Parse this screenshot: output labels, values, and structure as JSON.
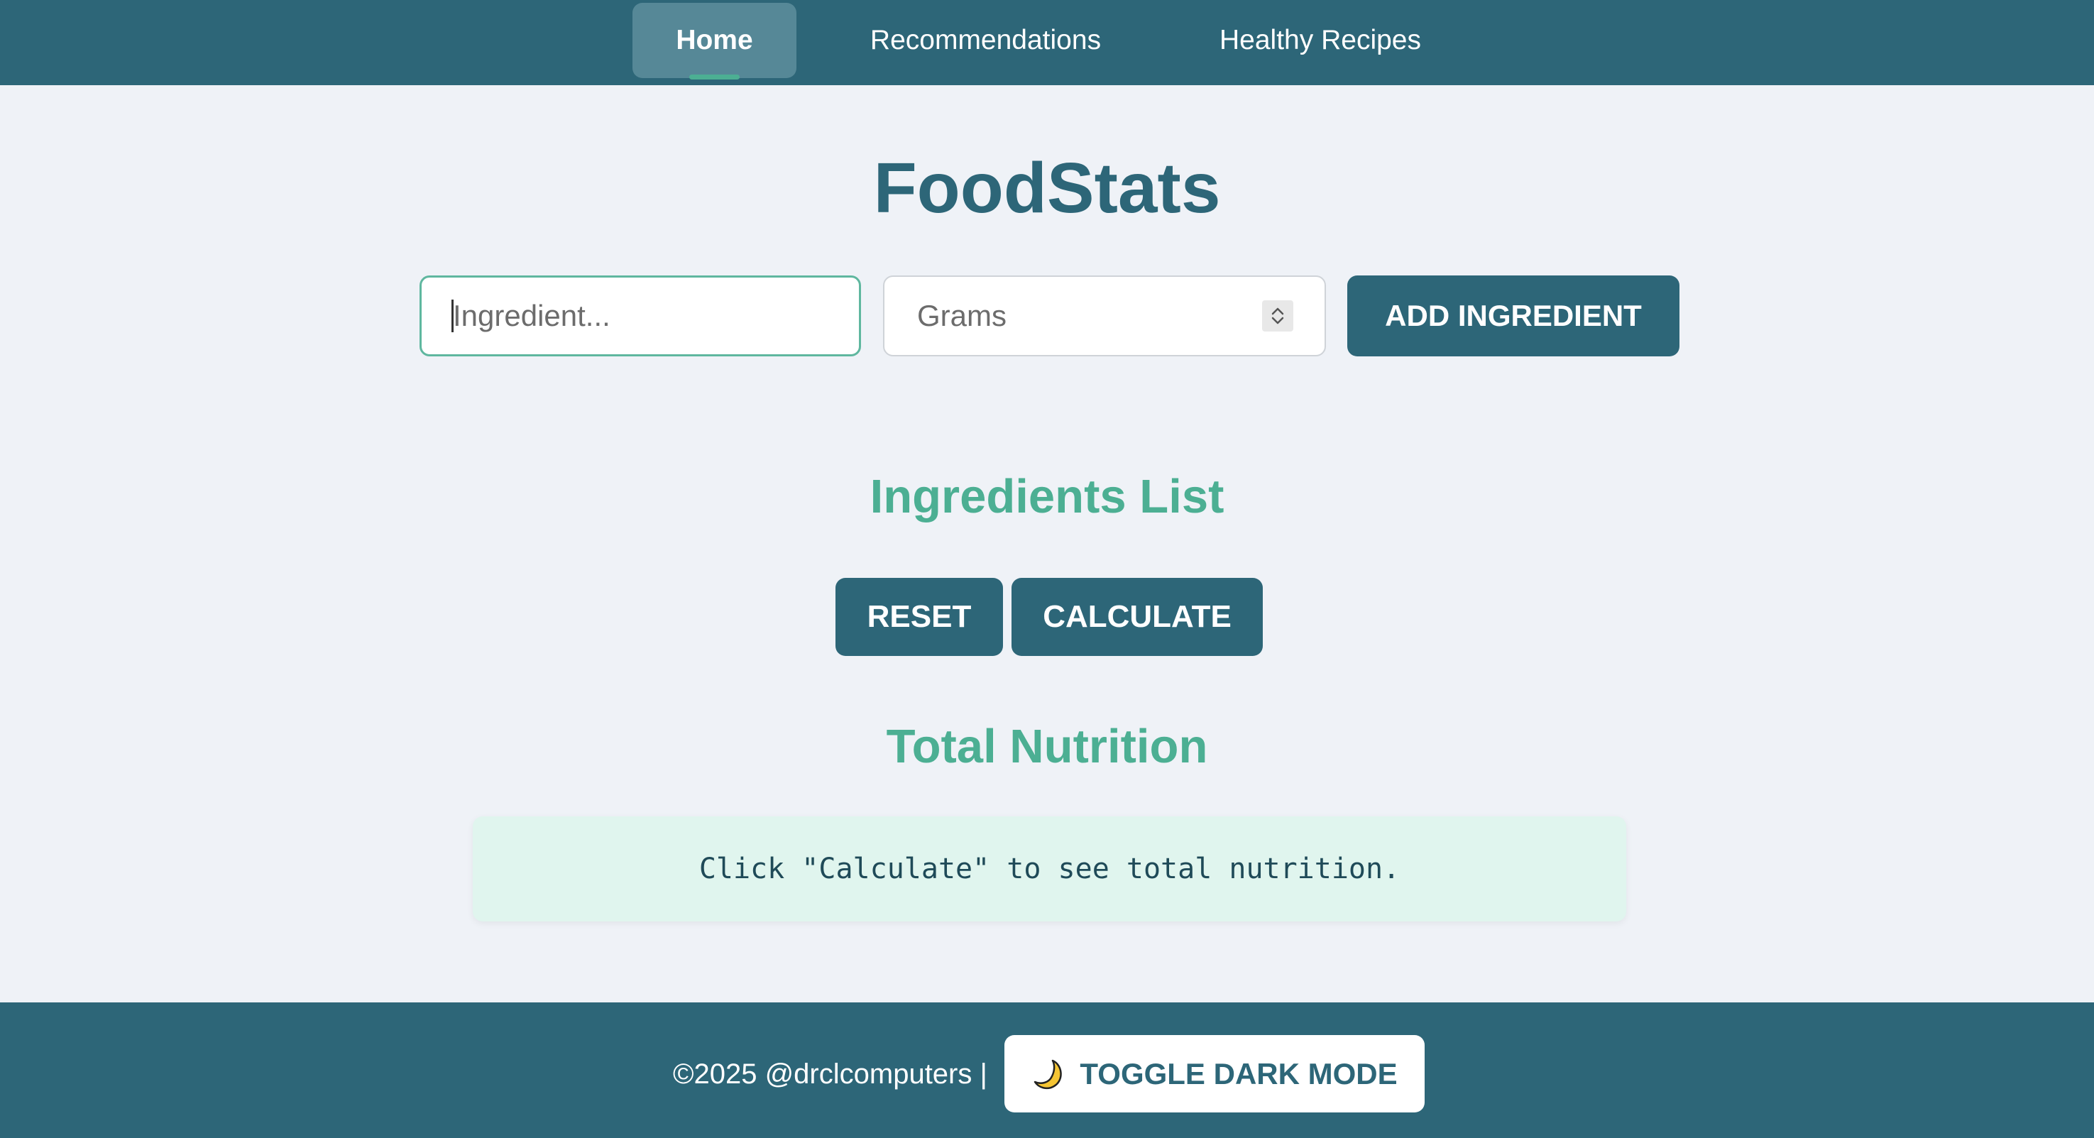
{
  "nav": {
    "items": [
      {
        "label": "Home",
        "active": true
      },
      {
        "label": "Recommendations",
        "active": false
      },
      {
        "label": "Healthy Recipes",
        "active": false
      }
    ]
  },
  "main": {
    "title": "FoodStats",
    "form": {
      "ingredient_placeholder": "Ingredient...",
      "ingredient_value": "",
      "grams_placeholder": "Grams",
      "add_button_label": "ADD INGREDIENT"
    },
    "ingredients_heading": "Ingredients List",
    "reset_label": "RESET",
    "calculate_label": "CALCULATE",
    "total_heading": "Total Nutrition",
    "result_text": "Click \"Calculate\" to see total nutrition."
  },
  "footer": {
    "copyright": "©2025 @drclcomputers |",
    "toggle_label": "TOGGLE DARK MODE",
    "toggle_icon": "moon-icon"
  },
  "colors": {
    "primary": "#2d6678",
    "accent": "#4caf93",
    "background": "#eff2f7",
    "result_background": "#e0f5ee"
  }
}
